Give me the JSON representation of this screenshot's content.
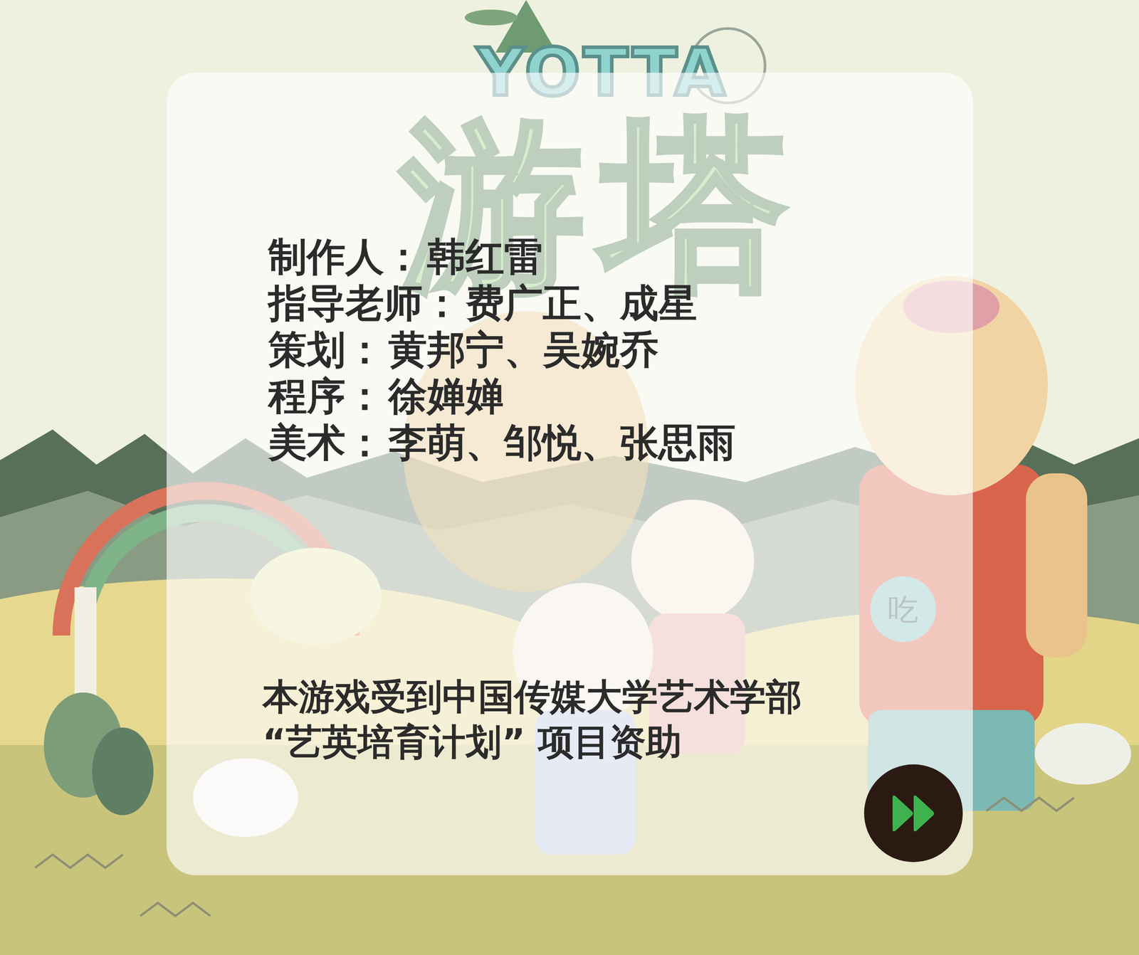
{
  "logo": {
    "latin": "YOTTA",
    "title": "游塔"
  },
  "credits": [
    {
      "role": "制作人：",
      "names": "韩红雷"
    },
    {
      "role": "指导老师：",
      "names": "费广正、成星"
    },
    {
      "role": "策划：",
      "names": "黄邦宁、吴婉乔"
    },
    {
      "role": "程序：",
      "names": "徐婵婵"
    },
    {
      "role": "美术：",
      "names": "李萌、邹悦、张思雨"
    }
  ],
  "funding": [
    "本游戏受到中国传媒大学艺术学部",
    "“艺英培育计划” 项目资助"
  ],
  "illustration": {
    "belly_label": "吃"
  }
}
